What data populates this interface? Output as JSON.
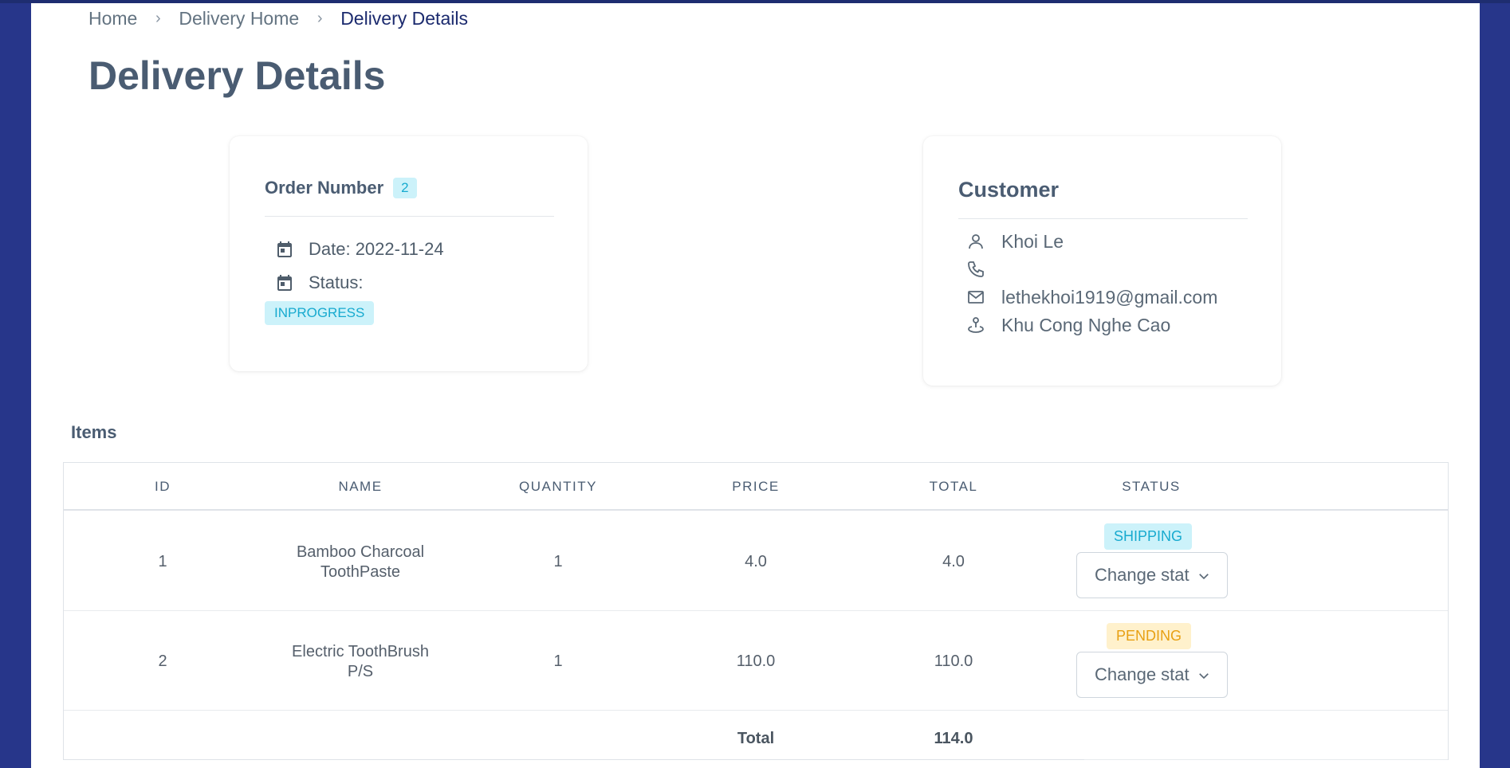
{
  "breadcrumb": {
    "home": "Home",
    "delivery_home": "Delivery Home",
    "current": "Delivery Details"
  },
  "page_title": "Delivery Details",
  "order": {
    "title": "Order Number",
    "number": "2",
    "date": "Date: 2022-11-24",
    "status_label": "Status:",
    "status": "INPROGRESS"
  },
  "customer": {
    "title": "Customer",
    "name": "Khoi Le",
    "phone": "",
    "email": "lethekhoi1919@gmail.com",
    "address": "Khu Cong Nghe Cao"
  },
  "items": {
    "title": "Items",
    "columns": [
      "ID",
      "NAME",
      "QUANTITY",
      "PRICE",
      "TOTAL",
      "STATUS"
    ],
    "rows": [
      {
        "id": "1",
        "name_line1": "Bamboo Charcoal",
        "name_line2": "ToothPaste",
        "quantity": "1",
        "price": "4.0",
        "total": "4.0",
        "status": "SHIPPING",
        "select_label": "Change stat"
      },
      {
        "id": "2",
        "name_line1": "Electric ToothBrush",
        "name_line2": "P/S",
        "quantity": "1",
        "price": "110.0",
        "total": "110.0",
        "status": "PENDING",
        "select_label": "Change stat"
      }
    ],
    "total_label": "Total",
    "grand_total": "114.0"
  },
  "colors": {
    "frame": "#27368a",
    "info": "#17aacf",
    "warning": "#e8a013",
    "title": "#4a5c72"
  }
}
